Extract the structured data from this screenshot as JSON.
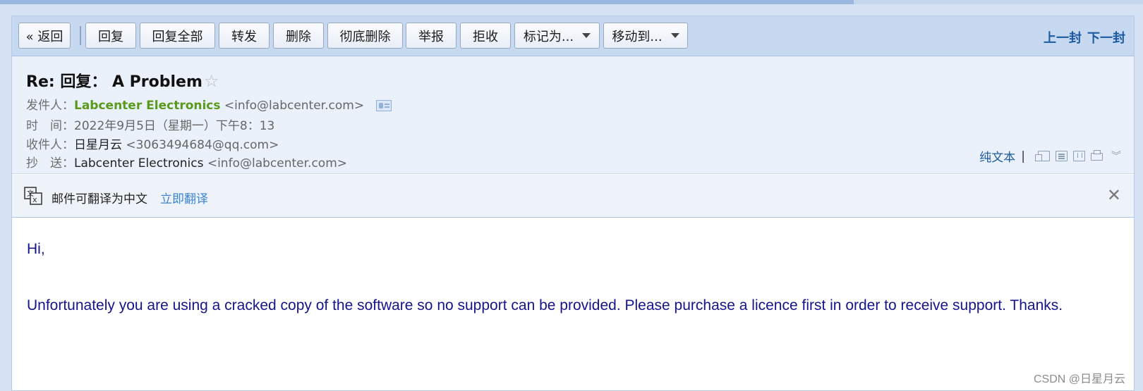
{
  "toolbar": {
    "back": "« 返回",
    "reply": "回复",
    "reply_all": "回复全部",
    "forward": "转发",
    "delete": "删除",
    "delete_permanent": "彻底删除",
    "report": "举报",
    "reject": "拒收",
    "mark_as": "标记为...",
    "move_to": "移动到...",
    "prev": "上一封",
    "next": "下一封"
  },
  "header": {
    "subject": "Re: 回复：  A Problem",
    "from_label": "发件人：",
    "from_name": "Labcenter Electronics",
    "from_addr": "<info@labcenter.com>",
    "time_label": "时　间：",
    "time_value": "2022年9月5日（星期一）下午8：13",
    "to_label": "收件人：",
    "to_name": "日星月云",
    "to_addr": "<3063494684@qq.com>",
    "cc_label": "抄　送：",
    "cc_name": "Labcenter Electronics",
    "cc_addr": "<info@labcenter.com>",
    "plain_text": "纯文本",
    "separator": "|"
  },
  "translate": {
    "text": "邮件可翻译为中文",
    "link": "立即翻译"
  },
  "body": {
    "greeting": "Hi,",
    "paragraph": "Unfortunately you are using a cracked copy of the software so no support can be provided. Please purchase a licence first in order to receive support. Thanks."
  },
  "watermark": "CSDN @日星月云",
  "colors": {
    "sender_name": "#5a9a1a",
    "link": "#3b83d6",
    "body_text": "#14148c",
    "toolbar_bg": "#c6d9f1"
  }
}
